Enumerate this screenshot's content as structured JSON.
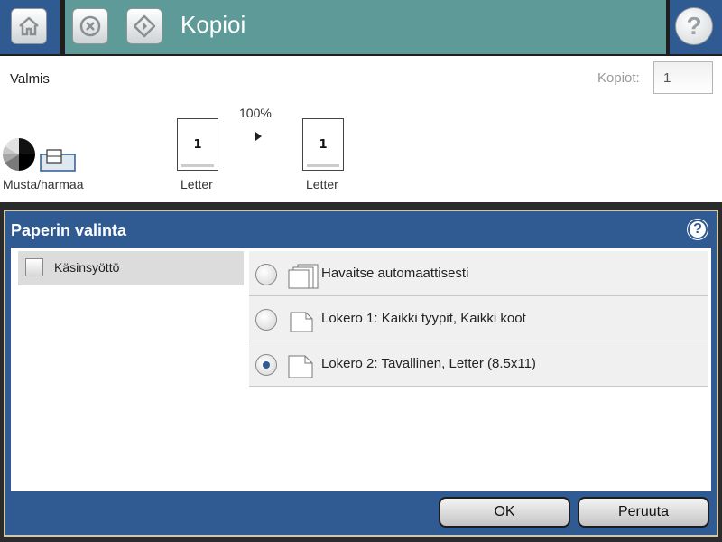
{
  "header": {
    "title": "Kopioi",
    "home_icon": "home-icon",
    "stop_icon": "stop-icon",
    "start_icon": "start-icon",
    "help_icon": "help-icon",
    "help_glyph": "?"
  },
  "status": {
    "text": "Valmis",
    "copies_label": "Kopiot:",
    "copies_value": "1"
  },
  "preview": {
    "zoom": "100%",
    "source_page": "1",
    "dest_page": "1",
    "source_size": "Letter",
    "dest_size": "Letter",
    "color_mode": "Musta/harmaa"
  },
  "dialog": {
    "title": "Paperin valinta",
    "help_glyph": "?",
    "source": {
      "label": "Käsinsyöttö"
    },
    "options": [
      {
        "label": "Havaitse automaattisesti",
        "selected": false
      },
      {
        "label": "Lokero 1: Kaikki tyypit, Kaikki koot",
        "selected": false
      },
      {
        "label": "Lokero 2: Tavallinen, Letter (8.5x11)",
        "selected": true
      }
    ],
    "ok_label": "OK",
    "cancel_label": "Peruuta"
  },
  "colors": {
    "header_blue": "#2f5a92",
    "header_teal": "#5e9a98",
    "radio_selected": "#2f5a92"
  }
}
